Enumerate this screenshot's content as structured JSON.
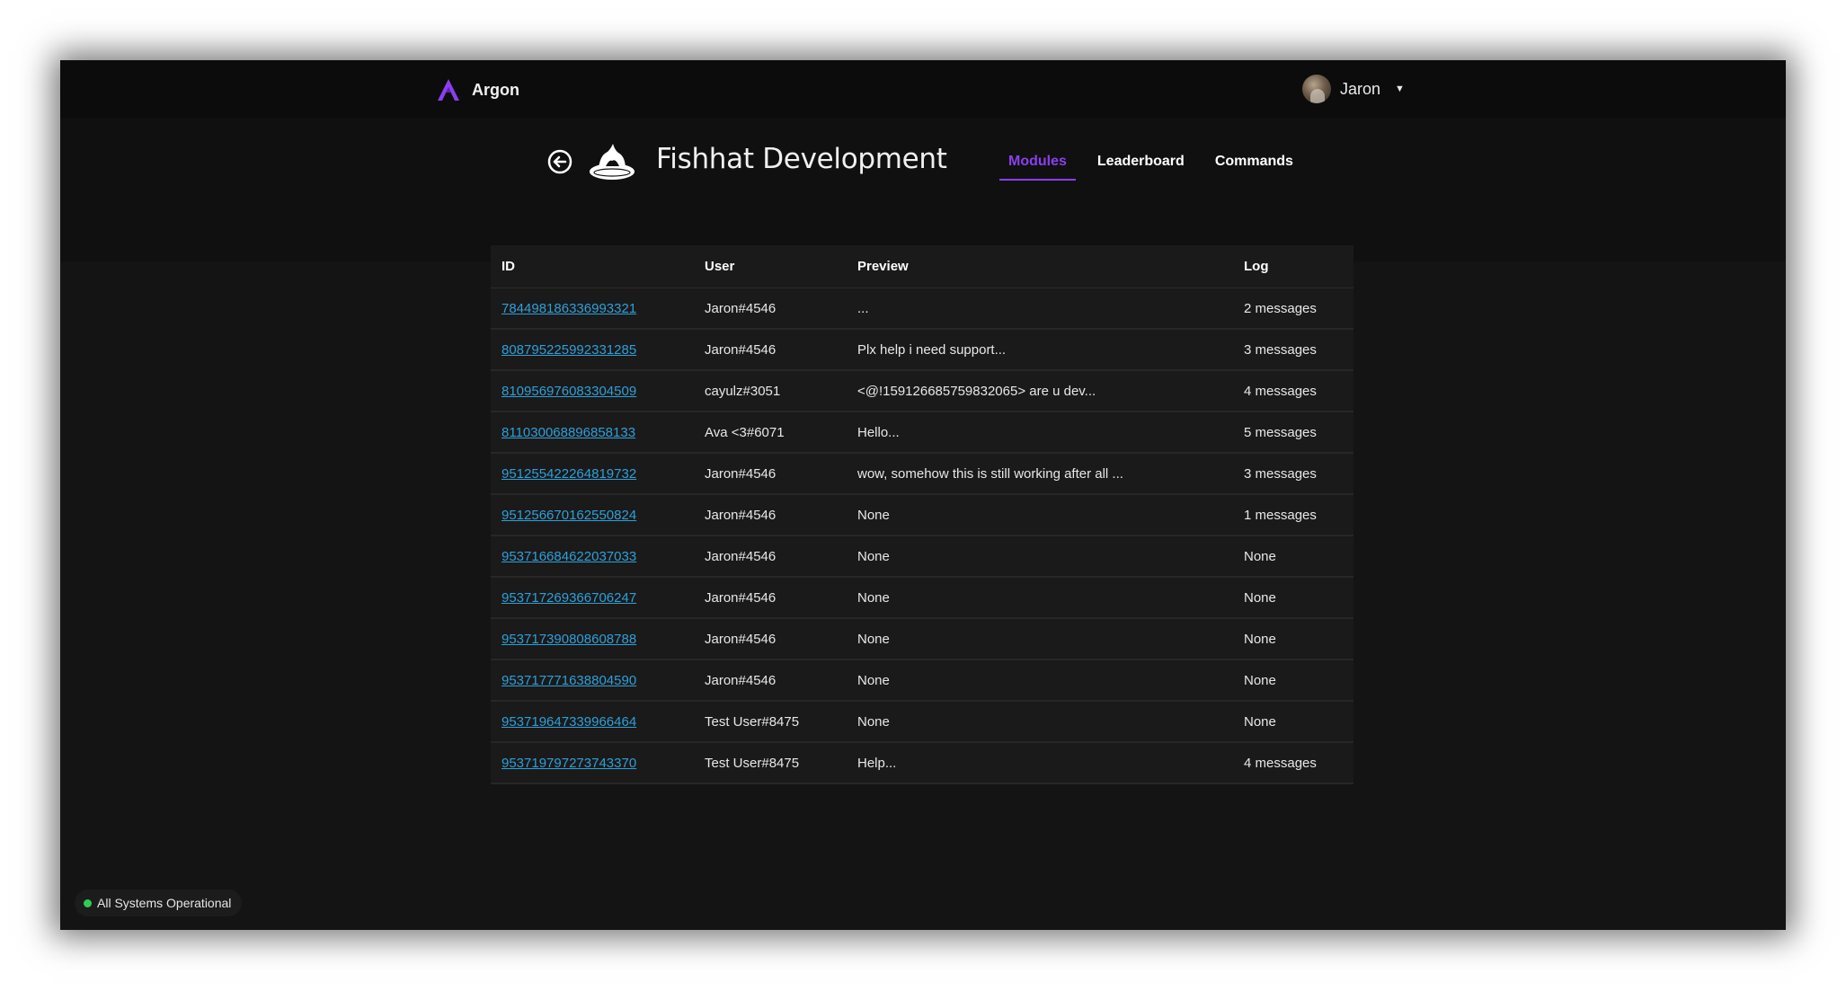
{
  "app": {
    "brand_name": "Argon",
    "brand_color": "#8a3ff0"
  },
  "user": {
    "name": "Jaron"
  },
  "server": {
    "name": "Fishhat Development"
  },
  "tabs": [
    {
      "label": "Modules",
      "active": true
    },
    {
      "label": "Leaderboard",
      "active": false
    },
    {
      "label": "Commands",
      "active": false
    }
  ],
  "table": {
    "headers": {
      "id": "ID",
      "user": "User",
      "preview": "Preview",
      "log": "Log"
    },
    "rows": [
      {
        "id": "784498186336993321",
        "user": "Jaron#4546",
        "preview": "...",
        "log": "2 messages"
      },
      {
        "id": "808795225992331285",
        "user": "Jaron#4546",
        "preview": "Plx help i need support...",
        "log": "3 messages"
      },
      {
        "id": "810956976083304509",
        "user": "cayulz#3051",
        "preview": "<@!159126685759832065> are u dev...",
        "log": "4 messages"
      },
      {
        "id": "811030068896858133",
        "user": "Ava <3#6071",
        "preview": "Hello...",
        "log": "5 messages"
      },
      {
        "id": "951255422264819732",
        "user": "Jaron#4546",
        "preview": "wow, somehow this is still working after all ...",
        "log": "3 messages"
      },
      {
        "id": "951256670162550824",
        "user": "Jaron#4546",
        "preview": "None",
        "log": "1 messages"
      },
      {
        "id": "953716684622037033",
        "user": "Jaron#4546",
        "preview": "None",
        "log": "None"
      },
      {
        "id": "953717269366706247",
        "user": "Jaron#4546",
        "preview": "None",
        "log": "None"
      },
      {
        "id": "953717390808608788",
        "user": "Jaron#4546",
        "preview": "None",
        "log": "None"
      },
      {
        "id": "953717771638804590",
        "user": "Jaron#4546",
        "preview": "None",
        "log": "None"
      },
      {
        "id": "953719647339966464",
        "user": "Test User#8475",
        "preview": "None",
        "log": "None"
      },
      {
        "id": "953719797273743370",
        "user": "Test User#8475",
        "preview": "Help...",
        "log": "4 messages"
      }
    ]
  },
  "status": {
    "text": "All Systems Operational",
    "color": "#2ecc57"
  },
  "icons": {
    "brand": "argon-logo-icon",
    "back": "back-arrow-icon",
    "server": "fishhat-server-icon",
    "caret": "caret-down-icon",
    "status": "status-dot-icon"
  }
}
